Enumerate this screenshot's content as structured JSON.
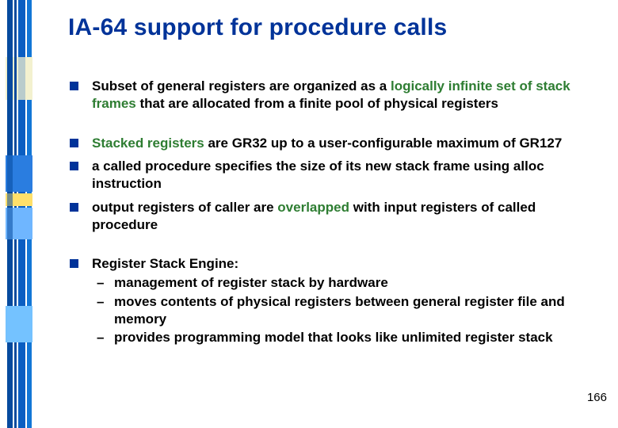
{
  "title": "IA-64 support for procedure calls",
  "bullets": [
    {
      "segments": [
        {
          "text": "Subset of general registers are organized as a "
        },
        {
          "text": "logically infinite set of stack frames",
          "accent": true
        },
        {
          "text": " that are allocated from a finite pool of physical registers"
        }
      ],
      "gapAfter": true
    },
    {
      "segments": [
        {
          "text": "Stacked registers",
          "accent": true
        },
        {
          "text": " are GR32 up to a user-configurable maximum of GR127"
        }
      ]
    },
    {
      "segments": [
        {
          "text": "a called procedure specifies the size of its new stack frame using alloc instruction"
        }
      ]
    },
    {
      "segments": [
        {
          "text": "output registers of caller are "
        },
        {
          "text": "overlapped",
          "accent": true
        },
        {
          "text": " with input registers of called procedure"
        }
      ],
      "gapAfter": true
    },
    {
      "segments": [
        {
          "text": "Register Stack Engine:"
        }
      ],
      "sub": [
        "management of register stack by hardware",
        "moves contents of physical registers between general register file and memory",
        "provides programming model that looks like unlimited register stack"
      ]
    }
  ],
  "pageNumber": "166",
  "dash": "–"
}
